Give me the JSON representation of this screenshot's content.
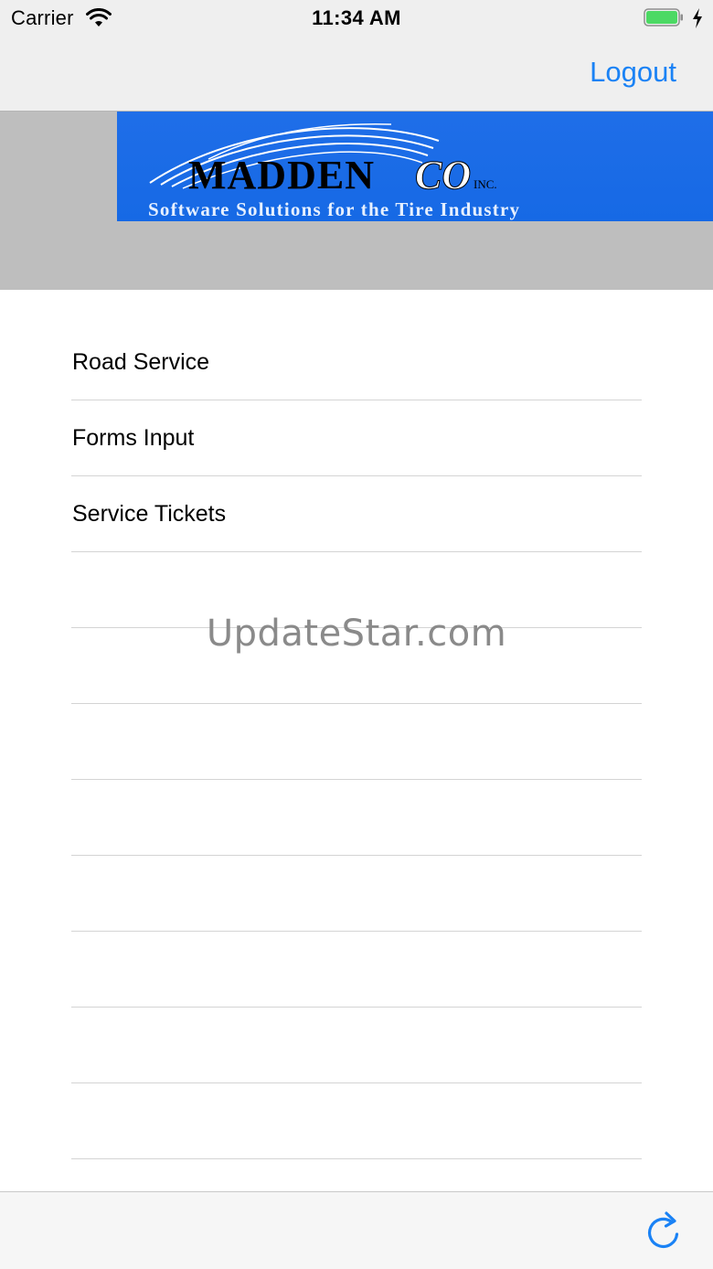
{
  "status_bar": {
    "carrier": "Carrier",
    "time": "11:34 AM",
    "battery_color": "#4cd964"
  },
  "nav": {
    "logout_label": "Logout",
    "accent_color": "#1a82f5"
  },
  "logo": {
    "name": "MADDEN",
    "co": "CO",
    "inc": "INC.",
    "tagline": "Software Solutions for the Tire Industry",
    "background": "#1f6ee8"
  },
  "menu": {
    "items": [
      {
        "label": "Road Service"
      },
      {
        "label": "Forms Input"
      },
      {
        "label": "Service Tickets"
      },
      {
        "label": ""
      },
      {
        "label": ""
      },
      {
        "label": ""
      },
      {
        "label": ""
      },
      {
        "label": ""
      },
      {
        "label": ""
      },
      {
        "label": ""
      },
      {
        "label": ""
      }
    ]
  },
  "watermark": "UpdateStar.com",
  "toolbar": {
    "refresh_icon": "refresh-icon"
  }
}
